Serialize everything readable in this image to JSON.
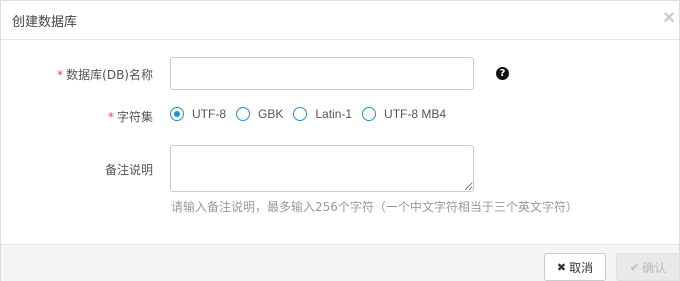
{
  "dialog": {
    "title": "创建数据库",
    "close_icon": "close-icon"
  },
  "form": {
    "db_name": {
      "required_mark": "*",
      "label": "数据库(DB)名称",
      "value": "",
      "help_glyph": "?"
    },
    "charset": {
      "required_mark": "*",
      "label": "字符集",
      "options": [
        "UTF-8",
        "GBK",
        "Latin-1",
        "UTF-8 MB4"
      ],
      "selected": "UTF-8"
    },
    "remark": {
      "label": "备注说明",
      "value": "",
      "hint": "请输入备注说明，最多输入256个字符（一个中文字符相当于三个英文字符）"
    }
  },
  "footer": {
    "cancel_label": "取消",
    "cancel_icon_glyph": "✖",
    "confirm_label": "确认",
    "confirm_icon_glyph": "✔"
  },
  "colors": {
    "accent": "#1e90d6",
    "required": "#e04b4b",
    "hint": "#9a9a9a"
  }
}
